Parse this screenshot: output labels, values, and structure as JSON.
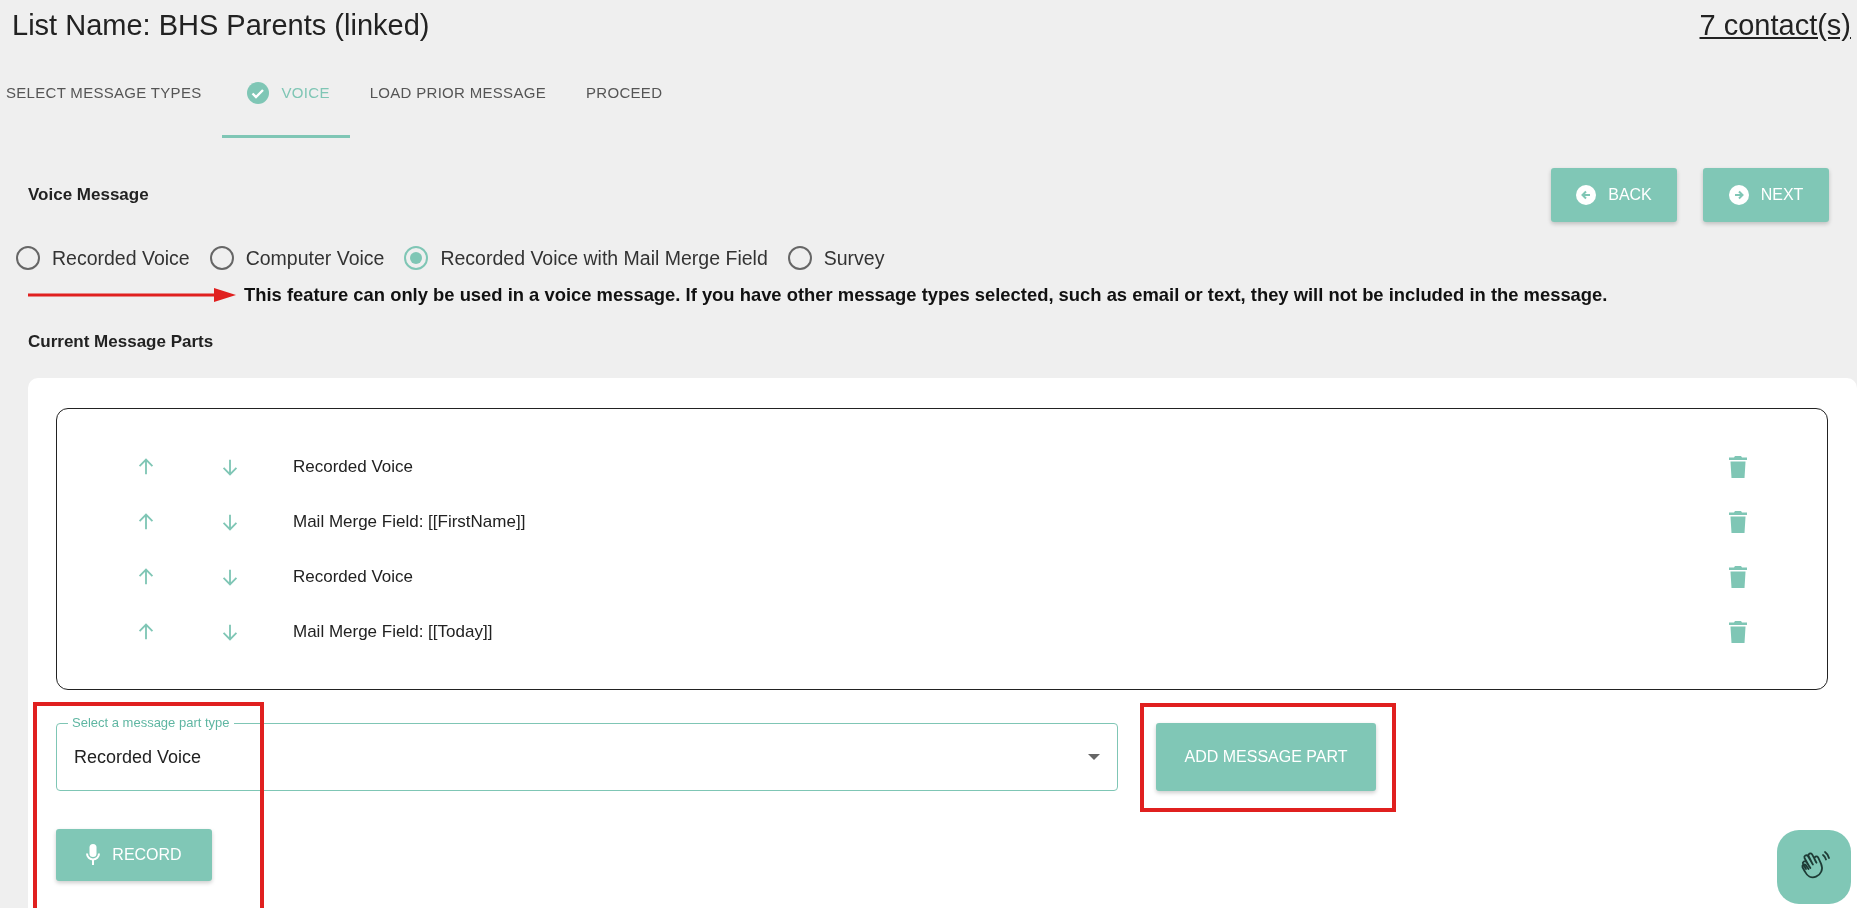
{
  "header": {
    "list_name": "List Name: BHS Parents (linked)",
    "contacts_link": "7 contact(s)"
  },
  "steps": [
    {
      "label": "SELECT MESSAGE TYPES",
      "selected": false,
      "completed": false
    },
    {
      "label": "VOICE",
      "selected": true,
      "completed": true
    },
    {
      "label": "LOAD PRIOR MESSAGE",
      "selected": false,
      "completed": false
    },
    {
      "label": "PROCEED",
      "selected": false,
      "completed": false
    }
  ],
  "section_title": "Voice Message",
  "nav_buttons": [
    {
      "label": "BACK",
      "kind": "back"
    },
    {
      "label": "NEXT",
      "kind": "next"
    }
  ],
  "voice_options": [
    {
      "label": "Recorded Voice",
      "selected": false
    },
    {
      "label": "Computer Voice",
      "selected": false
    },
    {
      "label": "Recorded Voice with Mail Merge Field",
      "selected": true
    },
    {
      "label": "Survey",
      "selected": false
    }
  ],
  "warning": "This feature can only be used in a voice message. If you have other message types selected, such as email or text, they will not be included in the message.",
  "parts_title": "Current Message Parts",
  "message_parts": [
    {
      "label": "Recorded Voice"
    },
    {
      "label": "Mail Merge Field: [[FirstName]]"
    },
    {
      "label": "Recorded Voice"
    },
    {
      "label": "Mail Merge Field: [[Today]]"
    }
  ],
  "part_type_select": {
    "label": "Select a message part type",
    "value": "Recorded Voice"
  },
  "add_button": "ADD MESSAGE PART",
  "record_button": "RECORD"
}
